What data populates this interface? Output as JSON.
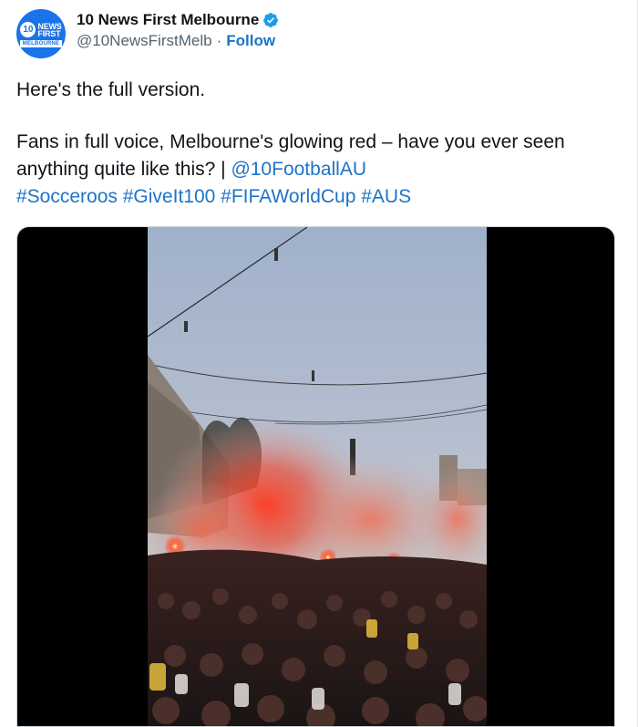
{
  "account": {
    "display_name": "10 News First Melbourne",
    "handle": "@10NewsFirstMelb",
    "separator": "·",
    "follow_label": "Follow",
    "avatar": {
      "ten": "10",
      "news": "NEWS",
      "first": "FIRST",
      "melbourne": "MELBOURNE",
      "color": "#1a73e8"
    },
    "verified_icon": "verified-badge-icon"
  },
  "tweet": {
    "line1": "Here's the full version.",
    "line2_text": "Fans in full voice, Melbourne's glowing red – have you ever seen anything quite like this? | ",
    "mention": "@10FootballAU",
    "hashtags": [
      "#Socceroos",
      "#GiveIt100",
      "#FIFAWorldCup",
      "#AUS"
    ]
  },
  "media": {
    "type": "video",
    "scene": "crowd-with-red-flares"
  },
  "colors": {
    "link": "#1d73c9",
    "secondary_text": "#536471",
    "verified": "#1d9bf0"
  }
}
